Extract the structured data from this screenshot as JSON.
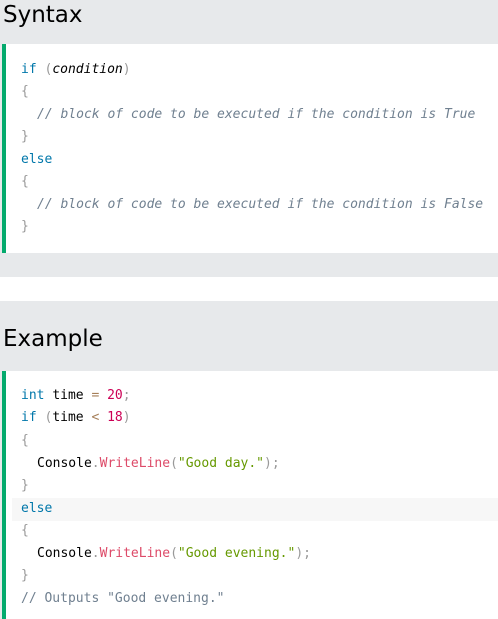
{
  "syntax": {
    "title": "Syntax",
    "lines": {
      "if_kw": "if",
      "open_paren": "(",
      "condition": "condition",
      "close_paren": ")",
      "brace_open_1": "{",
      "comment_true": "// block of code to be executed if the condition is True",
      "brace_close_1": "}",
      "else_kw": "else",
      "brace_open_2": "{",
      "comment_false": "// block of code to be executed if the condition is False",
      "brace_close_2": "}"
    }
  },
  "example": {
    "title": "Example",
    "lines": {
      "int_kw": "int",
      "var_time": "time",
      "assign": "=",
      "num_20": "20",
      "semi": ";",
      "if_kw": "if",
      "open_paren": "(",
      "var_time2": "time",
      "lt": "<",
      "num_18": "18",
      "close_paren": ")",
      "brace_open_1": "{",
      "console_1": "Console",
      "dot_1": ".",
      "writeline_1": "WriteLine",
      "paren_open_1": "(",
      "str_day": "\"Good day.\"",
      "paren_close_1": ");",
      "brace_close_1": "}",
      "else_kw": "else",
      "brace_open_2": "{",
      "console_2": "Console",
      "dot_2": ".",
      "writeline_2": "WriteLine",
      "paren_open_2": "(",
      "str_evening": "\"Good evening.\"",
      "paren_close_2": ");",
      "brace_close_2": "}",
      "comment_output": "// Outputs \"Good evening.\""
    }
  },
  "colors": {
    "accent_border": "#04aa6d",
    "section_bg": "#e7e9eb",
    "keyword": "#0077aa",
    "comment": "#708090",
    "number": "#cc0055",
    "function": "#dd4a68",
    "string": "#669900",
    "punctuation": "#999999"
  }
}
